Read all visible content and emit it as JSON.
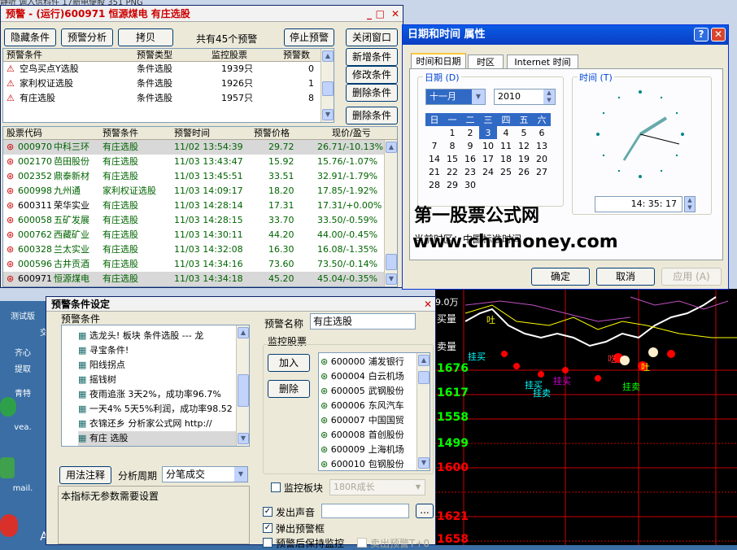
{
  "desktop": {
    "top_text": "静听  调入信科件  17新电便股  351 PNG",
    "icon_labels": [
      "测试版",
      "交",
      "齐心",
      "提取",
      "青特",
      "vea.",
      "mail.",
      "A"
    ]
  },
  "chart": {
    "labels": {
      "top": "9.0万",
      "vol1": "买量",
      "vol2": "卖量"
    },
    "prices": [
      "1676",
      "1617",
      "1558",
      "1499",
      "1600",
      "1621",
      "1658"
    ],
    "buy_label": "挂买",
    "sell_label": "挂卖",
    "eat_label": "吃",
    "spit_label": "吐"
  },
  "alert_window": {
    "title": "预警 - (运行)600971 恒源煤电 有庄选股",
    "buttons": {
      "hide": "隐藏条件",
      "analyze": "预警分析",
      "copy": "拷贝",
      "stop": "停止预警",
      "close": "关闭窗口",
      "add": "新增条件",
      "edit": "修改条件",
      "del": "删除条件",
      "del2": "删除条件"
    },
    "count_text": "共有45个预警",
    "cond_headers": [
      "预警条件",
      "预警类型",
      "监控股票",
      "预警数"
    ],
    "conditions": [
      {
        "name": "空鸟买点Y选股",
        "type": "条件选股",
        "stocks": "1939只",
        "count": "0"
      },
      {
        "name": "家利权证选股",
        "type": "条件选股",
        "stocks": "1926只",
        "count": "1"
      },
      {
        "name": "有庄选股",
        "type": "条件选股",
        "stocks": "1957只",
        "count": "8"
      }
    ],
    "stock_headers": [
      "股票代码",
      "预警条件",
      "预警时间",
      "预警价格",
      "现价/盈亏"
    ],
    "stocks": [
      {
        "code": "000970",
        "name": "中科三环",
        "cond": "有庄选股",
        "time": "11/02 13:54:39",
        "price": "29.72",
        "now": "26.71/-10.13%"
      },
      {
        "code": "002170",
        "name": "芭田股份",
        "cond": "有庄选股",
        "time": "11/03 13:43:47",
        "price": "15.92",
        "now": "15.76/-1.07%"
      },
      {
        "code": "002352",
        "name": "鼎泰新材",
        "cond": "有庄选股",
        "time": "11/03 13:45:51",
        "price": "33.51",
        "now": "32.91/-1.79%"
      },
      {
        "code": "600998",
        "name": "九州通",
        "cond": "家利权证选股",
        "time": "11/03 14:09:17",
        "price": "18.20",
        "now": "17.85/-1.92%"
      },
      {
        "code": "600311",
        "name": "荣华实业",
        "cond": "有庄选股",
        "time": "11/03 14:28:14",
        "price": "17.31",
        "now": "17.31/+0.00%"
      },
      {
        "code": "600058",
        "name": "五矿发展",
        "cond": "有庄选股",
        "time": "11/03 14:28:15",
        "price": "33.70",
        "now": "33.50/-0.59%"
      },
      {
        "code": "000762",
        "name": "西藏矿业",
        "cond": "有庄选股",
        "time": "11/03 14:30:11",
        "price": "44.20",
        "now": "44.00/-0.45%"
      },
      {
        "code": "600328",
        "name": "兰太实业",
        "cond": "有庄选股",
        "time": "11/03 14:32:08",
        "price": "16.30",
        "now": "16.08/-1.35%"
      },
      {
        "code": "000596",
        "name": "古井贡酒",
        "cond": "有庄选股",
        "time": "11/03 14:34:16",
        "price": "73.60",
        "now": "73.50/-0.14%"
      },
      {
        "code": "600971",
        "name": "恒源煤电",
        "cond": "有庄选股",
        "time": "11/03 14:34:18",
        "price": "45.20",
        "now": "45.04/-0.35%"
      }
    ]
  },
  "datetime_window": {
    "title": "日期和时间 属性",
    "tabs": [
      "时间和日期",
      "时区",
      "Internet 时间"
    ],
    "date_group": "日期 (D)",
    "time_group": "时间 (T)",
    "month": "十一月",
    "year": "2010",
    "weekdays": [
      "日",
      "一",
      "二",
      "三",
      "四",
      "五",
      "六"
    ],
    "days": [
      [
        "",
        "1",
        "2",
        "3",
        "4",
        "5",
        "6"
      ],
      [
        "7",
        "8",
        "9",
        "10",
        "11",
        "12",
        "13"
      ],
      [
        "14",
        "15",
        "16",
        "17",
        "18",
        "19",
        "20"
      ],
      [
        "21",
        "22",
        "23",
        "24",
        "25",
        "26",
        "27"
      ],
      [
        "28",
        "29",
        "30",
        "",
        "",
        "",
        ""
      ]
    ],
    "selected_day": "3",
    "time": "14: 35: 17",
    "watermark1": "第一股票公式网",
    "watermark2": "www.chnmoney.com",
    "timezone": "当前时区：中国标准时间",
    "ok": "确定",
    "cancel": "取消",
    "apply": "应用 (A)"
  },
  "setup_window": {
    "title": "预警条件设定",
    "cond_label": "预警条件",
    "list": [
      "选龙头!  板块 条件选股 --- 龙",
      "寻宝条件!",
      "阳线拐点",
      "摇钱树",
      "夜雨追涨 3天2%，成功率96.7%",
      "一天4% 5天5%利润，成功率98.52",
      "衣锦还乡 分析家公式网 http://",
      "有庄 选股"
    ],
    "usage_btn": "用法注释",
    "period_label": "分析周期",
    "period_value": "分笔成交",
    "desc": "本指标无参数需要设置",
    "name_label": "预警名称",
    "name_value": "有庄选股",
    "monitor_label": "监控股票",
    "add": "加入",
    "del": "删除",
    "monitor_list": [
      {
        "code": "600000",
        "name": "浦发银行"
      },
      {
        "code": "600004",
        "name": "白云机场"
      },
      {
        "code": "600005",
        "name": "武钢股份"
      },
      {
        "code": "600006",
        "name": "东风汽车"
      },
      {
        "code": "600007",
        "name": "中国国贸"
      },
      {
        "code": "600008",
        "name": "首创股份"
      },
      {
        "code": "600009",
        "name": "上海机场"
      },
      {
        "code": "600010",
        "name": "包钢股份"
      }
    ],
    "board_label": "监控板块",
    "board_value": "180R成长",
    "sound_label": "发出声音",
    "popup_label": "弹出预警框",
    "keep_label": "预警后保持监控",
    "sell_label": "卖出预警T+0",
    "browse": "..."
  }
}
